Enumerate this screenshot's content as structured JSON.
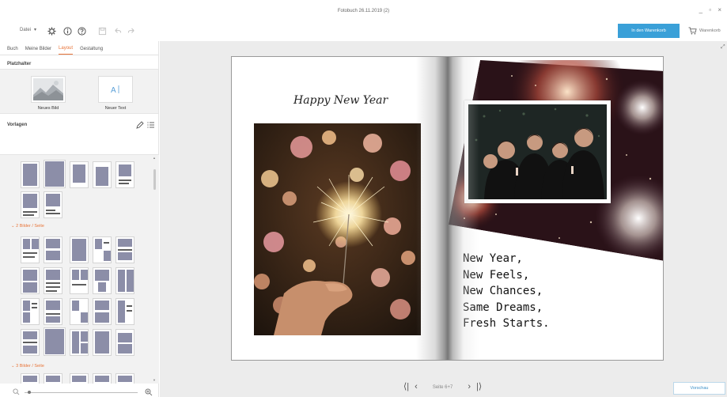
{
  "window": {
    "title": "Fotobuch 26.11.2019 (2)",
    "controls": "_ ▫ ×"
  },
  "toolbar": {
    "file_menu": "Datei",
    "cart_button": "In den Warenkorb",
    "cart_link": "Warenkorb",
    "icons": [
      "settings-icon",
      "info-icon",
      "help-icon",
      "save-icon",
      "undo-icon",
      "redo-icon"
    ]
  },
  "panel": {
    "tabs": [
      "Buch",
      "Meine Bilder",
      "Layout",
      "Gestaltung"
    ],
    "active_tab": "Layout",
    "placeholder_section": "Platzhalter",
    "placeholders": [
      {
        "label": "Neues Bild",
        "icon": "image-placeholder-icon"
      },
      {
        "label": "Neuer Text",
        "icon": "text-placeholder-icon"
      }
    ],
    "templates_section": "Vorlagen",
    "groups": [
      {
        "label": "2 Bilder / Seite"
      },
      {
        "label": "3 Bilder / Seite"
      }
    ]
  },
  "book": {
    "left_heading": "Happy New Year",
    "poem": [
      "New Year,",
      "New Feels,",
      "New Chances,",
      "Same Dreams,",
      "Fresh Starts."
    ]
  },
  "footer": {
    "page_label": "Seite 6+7",
    "preview_button": "Vorschau"
  },
  "colors": {
    "accent": "#e8753a",
    "primary_button": "#3aa0d8",
    "template_photo": "#8c8ea8"
  }
}
